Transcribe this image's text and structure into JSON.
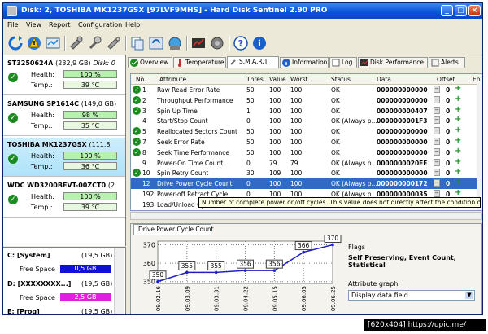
{
  "window": {
    "title": "Disk: 2, TOSHIBA MK1237GSX [97LVF9MHS] - Hard Disk Sentinel 2.90 PRO"
  },
  "menu": [
    "File",
    "View",
    "Report",
    "Configuration",
    "Help"
  ],
  "toolbar_icons": [
    "refresh-icon",
    "warning-icon",
    "report-icon",
    "settings-icon",
    "tools-icon",
    "disk-icon",
    "copy-icon",
    "sync-icon",
    "network-icon",
    "performance-icon",
    "sound-icon",
    "help-icon",
    "info-icon"
  ],
  "disks": [
    {
      "name": "ST3250624A",
      "capacity": "(232,9 GB)",
      "extra": "Disk: 0",
      "health_label": "Health:",
      "health": "100 %",
      "temp_label": "Temp.:",
      "temp": "39 °C",
      "selected": false
    },
    {
      "name": "SAMSUNG SP1614C",
      "capacity": "(149,0 GB)",
      "extra": "",
      "health_label": "Health:",
      "health": "98 %",
      "temp_label": "Temp.:",
      "temp": "35 °C",
      "selected": false
    },
    {
      "name": "TOSHIBA MK1237GSX",
      "capacity": "(111,8",
      "extra": "",
      "health_label": "Health:",
      "health": "100 %",
      "temp_label": "Temp.:",
      "temp": "36 °C",
      "selected": true
    },
    {
      "name": "WDC WD3200BEVT-00ZCT0",
      "capacity": "(2",
      "extra": "",
      "health_label": "Health:",
      "health": "100 %",
      "temp_label": "Temp.:",
      "temp": "39 °C",
      "selected": false
    }
  ],
  "volumes": [
    {
      "name": "C: [System]",
      "size": "(19,5 GB)",
      "free_label": "Free Space",
      "free": "0,5 GB",
      "bar_color": "#1010d8"
    },
    {
      "name": "D: [XXXXXXXX...]",
      "size": "(19,5 GB)",
      "free_label": "Free Space",
      "free": "2,5 GB",
      "bar_color": "#e020e0"
    },
    {
      "name": "E: [Prog]",
      "size": "(19,5 GB)"
    }
  ],
  "tabs": [
    "Overview",
    "Temperature",
    "S.M.A.R.T.",
    "Information",
    "Log",
    "Disk Performance",
    "Alerts"
  ],
  "active_tab": "S.M.A.R.T.",
  "table": {
    "headers": [
      "No.",
      "Attribute",
      "Thres...",
      "Value",
      "Worst",
      "Status",
      "Data",
      "Offset",
      "En"
    ],
    "rows": [
      {
        "no": "1",
        "attr": "Raw Read Error Rate",
        "thres": "50",
        "value": "100",
        "worst": "100",
        "status": "OK",
        "data": "000000000000",
        "offset": "0",
        "icon": true
      },
      {
        "no": "2",
        "attr": "Throughput Performance",
        "thres": "50",
        "value": "100",
        "worst": "100",
        "status": "OK",
        "data": "000000000000",
        "offset": "0",
        "icon": true
      },
      {
        "no": "3",
        "attr": "Spin Up Time",
        "thres": "1",
        "value": "100",
        "worst": "100",
        "status": "OK",
        "data": "000000000407",
        "offset": "0",
        "icon": true
      },
      {
        "no": "4",
        "attr": "Start/Stop Count",
        "thres": "0",
        "value": "100",
        "worst": "100",
        "status": "OK (Always p...",
        "data": "0000000001F3",
        "offset": "0",
        "icon": false
      },
      {
        "no": "5",
        "attr": "Reallocated Sectors Count",
        "thres": "50",
        "value": "100",
        "worst": "100",
        "status": "OK",
        "data": "000000000000",
        "offset": "0",
        "icon": true
      },
      {
        "no": "7",
        "attr": "Seek Error Rate",
        "thres": "50",
        "value": "100",
        "worst": "100",
        "status": "OK",
        "data": "000000000000",
        "offset": "0",
        "icon": true
      },
      {
        "no": "8",
        "attr": "Seek Time Performance",
        "thres": "50",
        "value": "100",
        "worst": "100",
        "status": "OK",
        "data": "000000000000",
        "offset": "0",
        "icon": true
      },
      {
        "no": "9",
        "attr": "Power-On Time Count",
        "thres": "0",
        "value": "79",
        "worst": "79",
        "status": "OK (Always p...",
        "data": "0000000020EE",
        "offset": "0",
        "icon": false
      },
      {
        "no": "10",
        "attr": "Spin Retry Count",
        "thres": "30",
        "value": "109",
        "worst": "100",
        "status": "OK",
        "data": "000000000000",
        "offset": "0",
        "icon": true
      },
      {
        "no": "12",
        "attr": "Drive Power Cycle Count",
        "thres": "0",
        "value": "100",
        "worst": "100",
        "status": "OK (Always p...",
        "data": "000000000172",
        "offset": "0",
        "icon": false,
        "selected": true
      },
      {
        "no": "192",
        "attr": "Power-off Retract Cycle",
        "thres": "0",
        "value": "100",
        "worst": "100",
        "status": "OK (Always p...",
        "data": "000000000035",
        "offset": "0",
        "icon": false
      },
      {
        "no": "193",
        "attr": "Load/Unload Cy...",
        "thres": "",
        "value": "",
        "worst": "",
        "status": "",
        "data": "",
        "offset": "",
        "icon": false
      }
    ]
  },
  "tooltip": "Number of complete power on/off cycles. This value does not directly affect the condition of the drive.",
  "chart_tab": "Drive Power Cycle Count",
  "flags": {
    "label": "Flags",
    "value": "Self Preserving, Event Count, Statistical",
    "graph_label": "Attribute graph",
    "dropdown": "Display data field"
  },
  "chart_data": {
    "type": "line",
    "x": [
      "09.02.16",
      "09.03.09",
      "09.03.31",
      "09.04.22",
      "09.05.15",
      "09.06.05",
      "09.06.25"
    ],
    "y_ticks": [
      350,
      360,
      370
    ],
    "ylim": [
      349,
      372
    ],
    "points": [
      {
        "x": "09.02.16",
        "y": 350
      },
      {
        "x": "09.03.09",
        "y": 355
      },
      {
        "x": "09.03.31",
        "y": 355
      },
      {
        "x": "09.04.22",
        "y": 356
      },
      {
        "x": "09.05.15",
        "y": 356
      },
      {
        "x": "09.06.05",
        "y": 366
      },
      {
        "x": "09.06.25",
        "y": 370
      }
    ],
    "line_color": "#2020c8"
  },
  "watermark": "[620x404] https://upic.me/"
}
